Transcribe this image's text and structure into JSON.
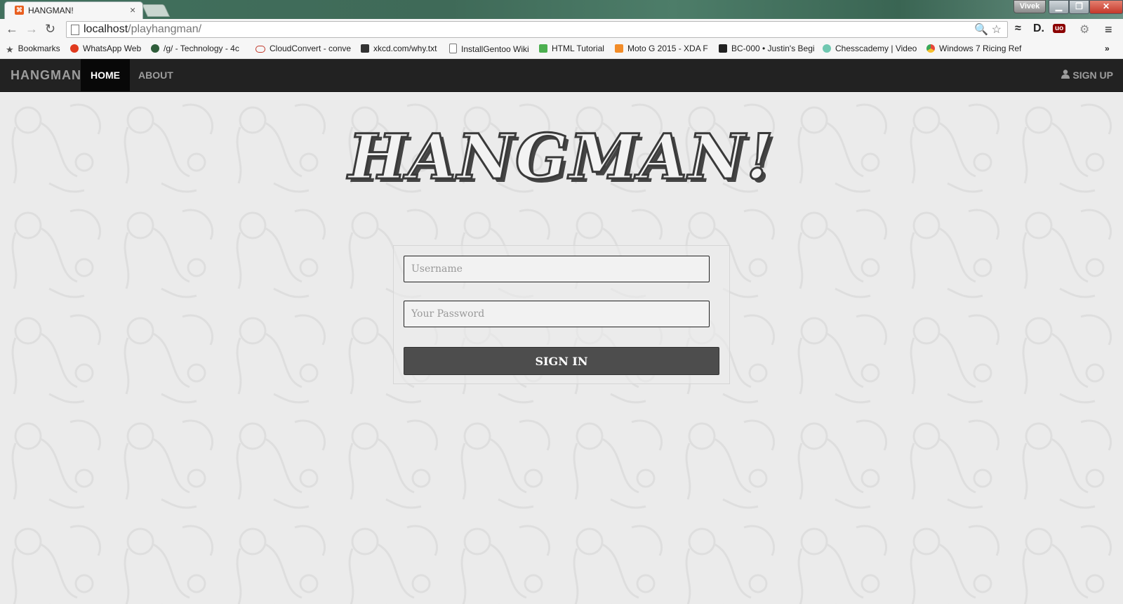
{
  "browser": {
    "tab_title": "HANGMAN!",
    "tab_close": "×",
    "user_badge": "Vivek",
    "window_buttons": {
      "minimize": "▁",
      "maximize": "❐",
      "close": "✕"
    },
    "nav": {
      "back": "←",
      "forward": "→",
      "reload": "↻"
    },
    "url_host": "localhost",
    "url_path": "/playhangman/",
    "omnibox_icons": "🔍 ☆",
    "extensions": [
      "≈",
      "D.",
      "uo",
      "⚙",
      "≡"
    ],
    "bookmarks": [
      {
        "label": "Bookmarks",
        "icon": "star-icon",
        "color": "#555555"
      },
      {
        "label": "WhatsApp Web",
        "icon": "alert-icon",
        "color": "#e03a1e"
      },
      {
        "label": "/g/ - Technology - 4c",
        "icon": "clover-icon",
        "color": "#2f5d3a"
      },
      {
        "label": "CloudConvert - conve",
        "icon": "cloud-icon",
        "color": "#c0392b"
      },
      {
        "label": "xkcd.com/why.txt",
        "icon": "xkcd-icon",
        "color": "#333333"
      },
      {
        "label": "InstallGentoo Wiki",
        "icon": "page-icon",
        "color": "#777777"
      },
      {
        "label": "HTML Tutorial",
        "icon": "w3-icon",
        "color": "#4caf50"
      },
      {
        "label": "Moto G 2015 - XDA F",
        "icon": "xda-icon",
        "color": "#f28c28"
      },
      {
        "label": "BC-000 • Justin's Begi",
        "icon": "bc-icon",
        "color": "#222222"
      },
      {
        "label": "Chesscademy | Video",
        "icon": "chess-icon",
        "color": "#6fc7b0"
      },
      {
        "label": "Windows 7 Ricing Ref",
        "icon": "chrome-icon",
        "color": "#e8b72a"
      }
    ],
    "bookmarks_overflow": "»"
  },
  "navbar": {
    "brand": "HANGMAN",
    "items": [
      {
        "label": "HOME",
        "active": true
      },
      {
        "label": "ABOUT",
        "active": false
      }
    ],
    "signup_label": "SIGN UP",
    "signup_icon": "user-icon"
  },
  "main": {
    "logo_text": "HANGMAN!",
    "form": {
      "username_placeholder": "Username",
      "password_placeholder": "Your Password",
      "submit_label": "SIGN IN"
    }
  },
  "colors": {
    "navbar_bg": "#222222",
    "page_bg": "#ebebeb",
    "button_bg": "#4d4d4d",
    "favicon": "#e95f1f"
  }
}
